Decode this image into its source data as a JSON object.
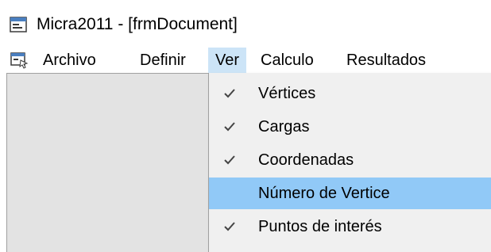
{
  "window": {
    "title": "Micra2011 - [frmDocument]",
    "app_icon": "form-window-icon"
  },
  "menubar": {
    "icon": "document-child-icon",
    "items": [
      {
        "label": "Archivo"
      },
      {
        "label": "Definir"
      },
      {
        "label": "Ver"
      },
      {
        "label": "Calculo"
      },
      {
        "label": "Resultados"
      }
    ],
    "active_item": "Ver"
  },
  "ver_menu": {
    "items": [
      {
        "label": "Vértices",
        "checked": true
      },
      {
        "label": "Cargas",
        "checked": true
      },
      {
        "label": "Coordenadas",
        "checked": true
      },
      {
        "label": "Número de Vertice",
        "checked": false,
        "highlighted": true
      },
      {
        "label": "Puntos de interés",
        "checked": true
      }
    ]
  },
  "colors": {
    "menu_active": "#cce4f7",
    "item_highlight": "#91c9f7",
    "menu_background": "#f0f0f0",
    "check_mark": "#444444",
    "workspace": "#e3e3e3"
  }
}
